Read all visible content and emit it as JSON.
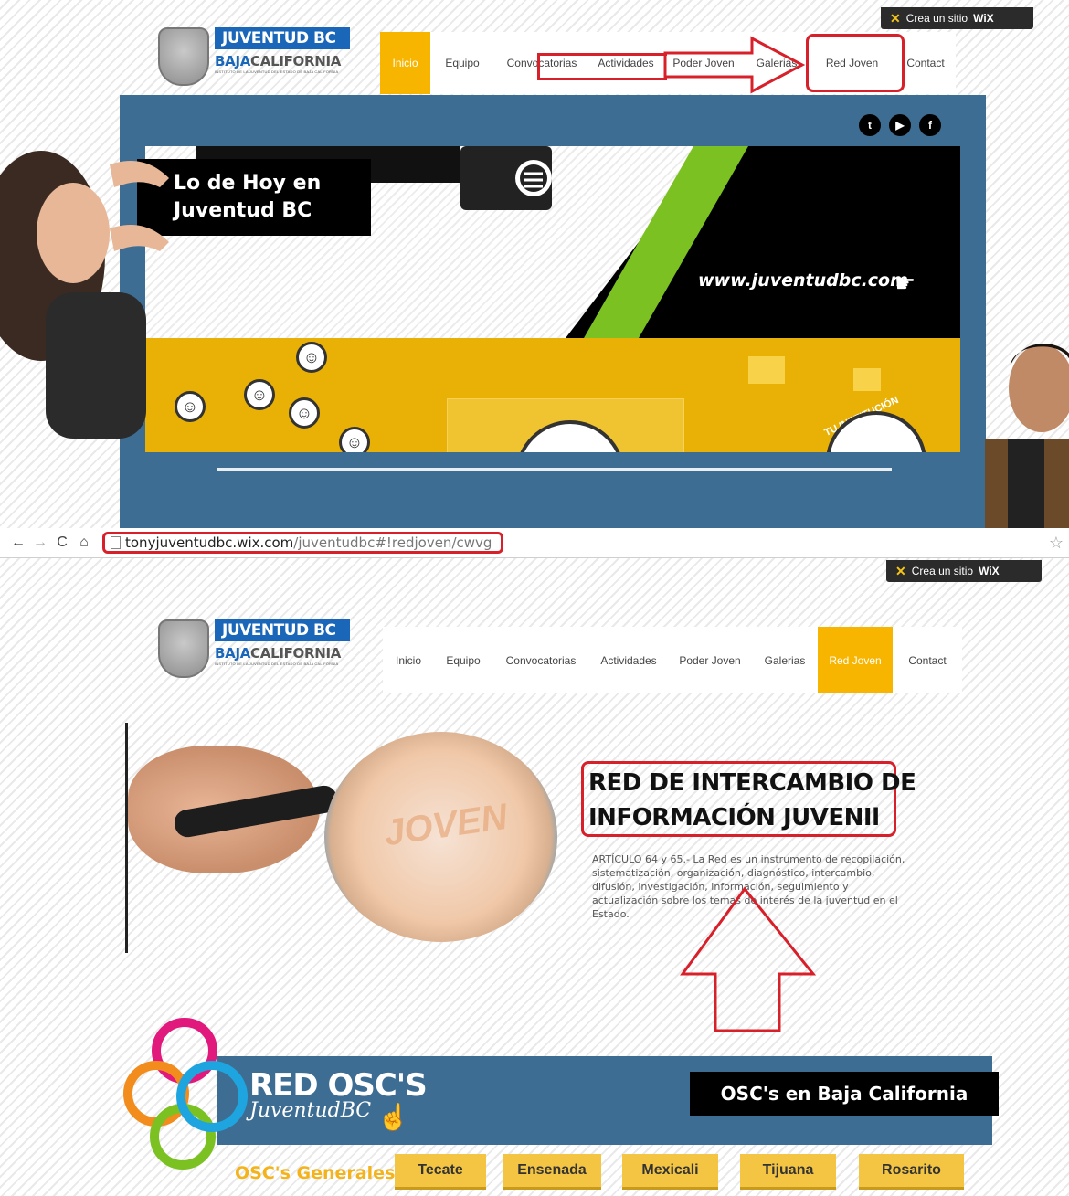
{
  "top_screenshot": {
    "wix_badge": {
      "label": "Crea un sitio",
      "brand": "WiX"
    },
    "logo": {
      "line1": "JUVENTUD BC",
      "line2_accent": "BAJA",
      "line2_rest": "CALIFORNIA",
      "tagline": "INSTITUTO DE LA JUVENTUD DEL ESTADO DE BAJA CALIFORNIA"
    },
    "nav": [
      {
        "label": "Inicio",
        "active": true
      },
      {
        "label": "Equipo",
        "active": false
      },
      {
        "label": "Convocatorias",
        "active": false
      },
      {
        "label": "Actividades",
        "active": false
      },
      {
        "label": "Poder Joven",
        "active": false
      },
      {
        "label": "Galerias",
        "active": false
      },
      {
        "label": "Red Joven",
        "active": false
      },
      {
        "label": "Contact",
        "active": false
      }
    ],
    "social_icons": [
      "twitter-icon",
      "youtube-icon",
      "facebook-icon"
    ],
    "slide": {
      "caption": "Lo de Hoy en Juventud BC",
      "url_text": "www.juventudbc.com",
      "badge_text": "TU INSTITUCIÓN"
    }
  },
  "browser": {
    "url_host": "tonyjuventudbc.wix.com",
    "url_path": "/juventudbc#!redjoven/cwvg"
  },
  "bottom_screenshot": {
    "wix_badge": {
      "label": "Crea un sitio",
      "brand": "WiX"
    },
    "logo": {
      "line1": "JUVENTUD BC",
      "line2_accent": "BAJA",
      "line2_rest": "CALIFORNIA",
      "tagline": "INSTITUTO DE LA JUVENTUD DEL ESTADO DE BAJA CALIFORNIA"
    },
    "nav": [
      {
        "label": "Inicio",
        "active": false
      },
      {
        "label": "Equipo",
        "active": false
      },
      {
        "label": "Convocatorias",
        "active": false
      },
      {
        "label": "Actividades",
        "active": false
      },
      {
        "label": "Poder Joven",
        "active": false
      },
      {
        "label": "Galerias",
        "active": false
      },
      {
        "label": "Red Joven",
        "active": true
      },
      {
        "label": "Contact",
        "active": false
      }
    ],
    "heading_line1": "RED DE INTERCAMBIO DE",
    "heading_line2": "INFORMACIÓN JUVENIl",
    "article": "ARTÍCULO 64 y 65.- La Red es un instrumento de recopilación, sistematización, organización, diagnóstico, intercambio, difusión, investigación, información, seguimiento y actualización sobre los temas de interés de la juventud en el Estado.",
    "lens_text": "JOVEN",
    "osc": {
      "title": "RED OSC'S",
      "subtitle": "JuventudBC",
      "right_label": "OSC's en Baja California",
      "generales_label": "OSC's Generales:",
      "cities": [
        "Tecate",
        "Ensenada",
        "Mexicali",
        "Tijuana",
        "Rosarito"
      ]
    }
  },
  "colors": {
    "accent_yellow": "#f7b500",
    "frame_blue": "#3e6d93",
    "annotation_red": "#d8202a",
    "logo_blue": "#1a66b8"
  }
}
